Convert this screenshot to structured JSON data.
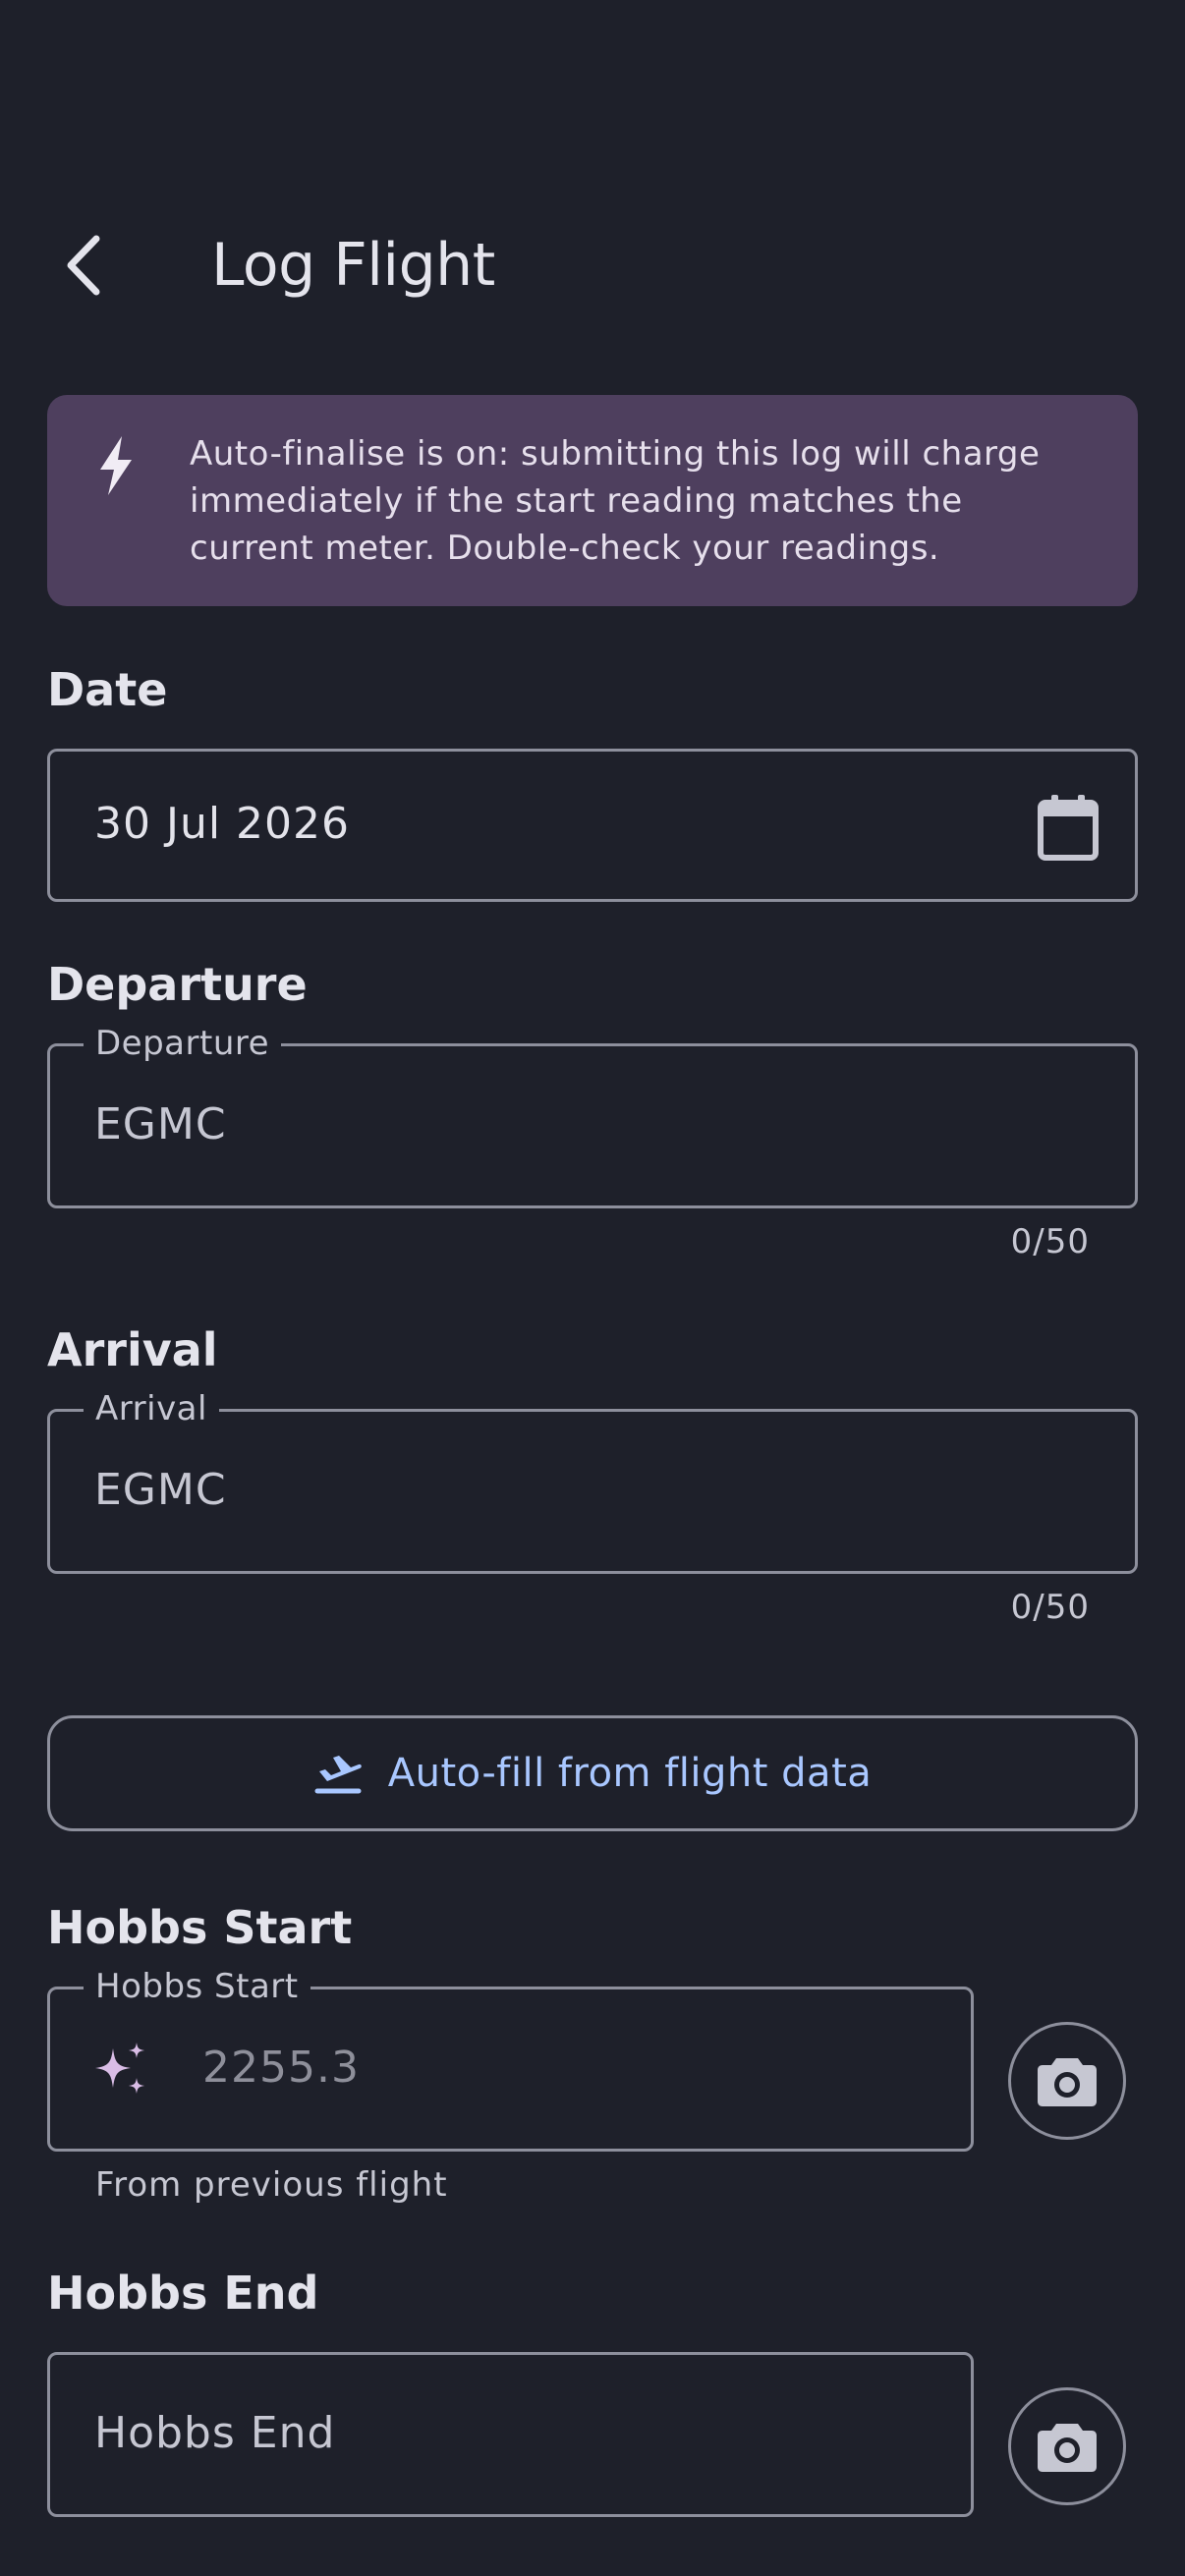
{
  "header": {
    "title": "Log Flight"
  },
  "banner": {
    "icon": "bolt-icon",
    "line1": "Auto-finalise is on: submitting this log will charge",
    "line2": "immediately if the start reading matches the",
    "line3": "current meter. Double-check your readings."
  },
  "date": {
    "label": "Date",
    "value": "30 Jul 2026"
  },
  "departure": {
    "section_label": "Departure",
    "floating_label": "Departure",
    "value": "EGMC",
    "counter": "0/50"
  },
  "arrival": {
    "section_label": "Arrival",
    "floating_label": "Arrival",
    "value": "EGMC",
    "counter": "0/50"
  },
  "autofill": {
    "label": "Auto-fill from flight data"
  },
  "hobbs_start": {
    "section_label": "Hobbs Start",
    "floating_label": "Hobbs Start",
    "value": "2255.3",
    "helper": "From previous flight"
  },
  "hobbs_end": {
    "section_label": "Hobbs End",
    "placeholder": "Hobbs End"
  },
  "colors": {
    "background": "#1e202a",
    "banner": "#4e3f5e",
    "accent": "#a9c7ff",
    "sparkle": "#d9bde6"
  }
}
